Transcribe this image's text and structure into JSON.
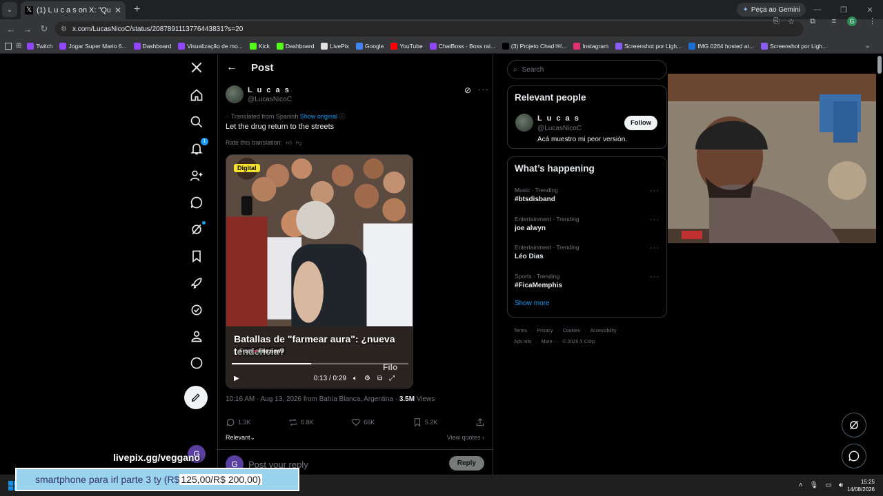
{
  "browser": {
    "tab_title": "(1) L u c a s on X: \"Que vuelva l…",
    "tab_icon": "x-logo-icon",
    "gemini_button": "Peça ao Gemini",
    "url": "x.com/LucasNicoC/status/2087891113776443831?s=20",
    "profile_initial": "G"
  },
  "bookmarks": [
    {
      "label": "Twitch",
      "color": "#9146ff"
    },
    {
      "label": "Jogar Super Mario 6...",
      "color": "#9146ff"
    },
    {
      "label": "Dashboard",
      "color": "#9146ff"
    },
    {
      "label": "Visualização de mo...",
      "color": "#9146ff"
    },
    {
      "label": "Kick",
      "color": "#53fc18"
    },
    {
      "label": "Dashboard",
      "color": "#53fc18"
    },
    {
      "label": "LivePix",
      "color": "#e0e0e0"
    },
    {
      "label": "Google",
      "color": "#4285f4"
    },
    {
      "label": "YouTube",
      "color": "#ff0000"
    },
    {
      "label": "ChatBoss - Boss rai...",
      "color": "#9146ff"
    },
    {
      "label": "(3) Projeto Chad ￼...",
      "color": "#000000"
    },
    {
      "label": "Instagram",
      "color": "#e1306c"
    },
    {
      "label": "Screenshot por Ligh...",
      "color": "#8a5cf6"
    },
    {
      "label": "IMG 0264 hosted at...",
      "color": "#1d6fd8"
    },
    {
      "label": "Screenshot por Ligh...",
      "color": "#8a5cf6"
    }
  ],
  "nav": {
    "notification_count": "1",
    "account_initial": "G"
  },
  "post": {
    "header_title": "Post",
    "author_name": "L u c a s",
    "author_handle": "@LucasNicoC",
    "translated_from": "Translated from Spanish",
    "show_original": "Show original",
    "text": "Let the drug return to the streets",
    "rate_translation": "Rate this translation:",
    "video": {
      "tag": "Digital",
      "caption": "Batallas de \"farmear aura\": ¿nueva tendencia?",
      "from_label": "From",
      "source": "Filo.news",
      "watermark": "Filo",
      "time": "0:13 / 0:29",
      "progress": 0.45
    },
    "timestamp": "10:16 AM · Aug 13, 2026 from Bahía Blanca, Argentina · ",
    "views_count": "3.5M",
    "views_label": " Views",
    "replies": "1.3K",
    "reposts": "6.8K",
    "likes": "66K",
    "bookmarks": "5.2K",
    "sort": "Relevant",
    "view_quotes": "View quotes",
    "reply_placeholder": "Post your reply",
    "reply_button": "Reply",
    "reply_avatar_initial": "G"
  },
  "sidebar": {
    "search_placeholder": "Search",
    "relevant_people_title": "Relevant people",
    "person": {
      "name": "L u c a s",
      "handle": "@LucasNicoC",
      "bio": "Acá muestro mi peor versión.",
      "follow_label": "Follow"
    },
    "happening_title": "What’s happening",
    "trends": [
      {
        "category": "Music · Trending",
        "name": "#btsdisband"
      },
      {
        "category": "Entertainment · Trending",
        "name": "joe alwyn"
      },
      {
        "category": "Entertainment · Trending",
        "name": "Léo Dias"
      },
      {
        "category": "Sports · Trending",
        "name": "#FicaMemphis"
      }
    ],
    "show_more": "Show more",
    "footer": [
      "Terms",
      "·",
      "Privacy",
      "·",
      "Cookies",
      "·",
      "Accessibility",
      "·",
      "Ads info",
      "·",
      "More ···",
      "© 2026 X Corp."
    ]
  },
  "overlay": {
    "livepix_url": "livepix.gg/veggano",
    "banner_text": "smartphone para irl parte 3 ty (R$ ",
    "banner_amount": "125,00/R$ 200,00)"
  },
  "taskbar": {
    "time": "15:25",
    "date": "14/08/2026"
  }
}
